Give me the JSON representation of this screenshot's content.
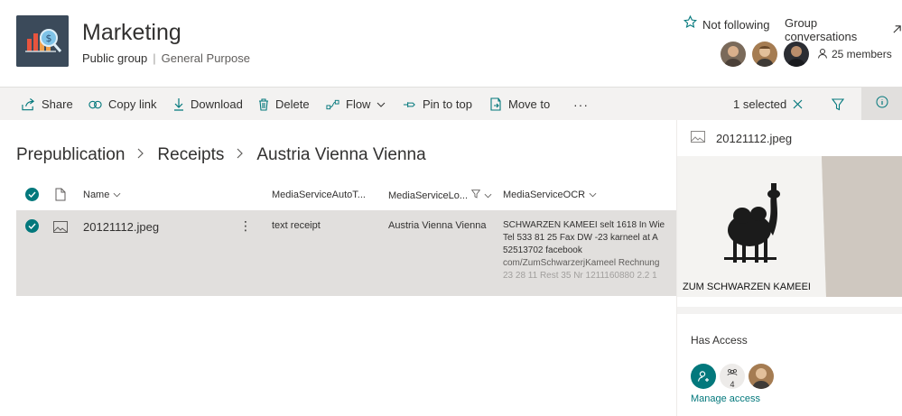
{
  "site": {
    "title": "Marketing",
    "privacy": "Public group",
    "classification": "General Purpose",
    "follow_label": "Not following",
    "group_conversations": "Group conversations",
    "members_label": "25 members"
  },
  "commands": {
    "share": "Share",
    "copy_link": "Copy link",
    "download": "Download",
    "delete": "Delete",
    "flow": "Flow",
    "pin_to_top": "Pin to top",
    "move_to": "Move to",
    "more": "···",
    "selected": "1 selected"
  },
  "breadcrumb": [
    "Prepublication",
    "Receipts",
    "Austria Vienna Vienna"
  ],
  "columns": {
    "name": "Name",
    "autotags": "MediaServiceAutoT...",
    "location": "MediaServiceLo...",
    "ocr": "MediaServiceOCR"
  },
  "row": {
    "name": "20121112.jpeg",
    "more": "⋮",
    "autotags": "text receipt",
    "location": "Austria Vienna Vienna",
    "ocr_lines": [
      "SCHWARZEN KAMEEI selt 1618 In Wie",
      "Tel 533 81 25 Fax DW -23 karneel at A",
      "52513702 facebook",
      "com/ZumSchwarzerjKameel Rechnung",
      "23 28 11 Rest 35 Nr 1211160880 2.2 1"
    ]
  },
  "pane": {
    "file_name": "20121112.jpeg",
    "preview_caption": "ZUM SCHWARZEN KAMEEI",
    "has_access": "Has Access",
    "group_count": "4",
    "manage_access": "Manage access"
  },
  "colors": {
    "accent": "#03787c",
    "command_bar": "#f3f2f1",
    "selected_row": "#e1dfdd"
  }
}
